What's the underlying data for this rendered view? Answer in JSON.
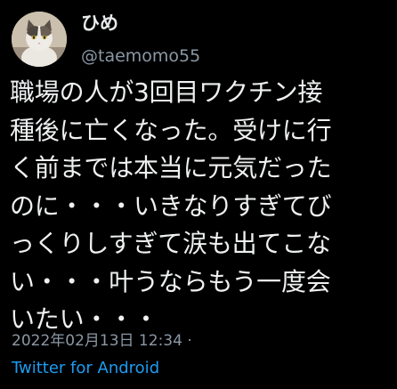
{
  "user": {
    "display_name": "ひめ",
    "handle": "@taemomo55",
    "avatar_icon": "cat-avatar-icon"
  },
  "tweet": {
    "lines": [
      "職場の人が3回目ワクチン接",
      "種後に亡くなった。受けに行",
      "く前までは本当に元気だった",
      "のに・・・いきなりすぎてび",
      "っくりしすぎて涙も出てこな",
      "い・・・叶うならもう一度会",
      "いたい・・・"
    ],
    "timestamp": "2022年02月13日 12:34 ·",
    "source": "Twitter for Android"
  },
  "colors": {
    "background": "#000000",
    "text": "#e7e9ea",
    "secondary": "#8b98a5",
    "link": "#1d9bf0"
  }
}
